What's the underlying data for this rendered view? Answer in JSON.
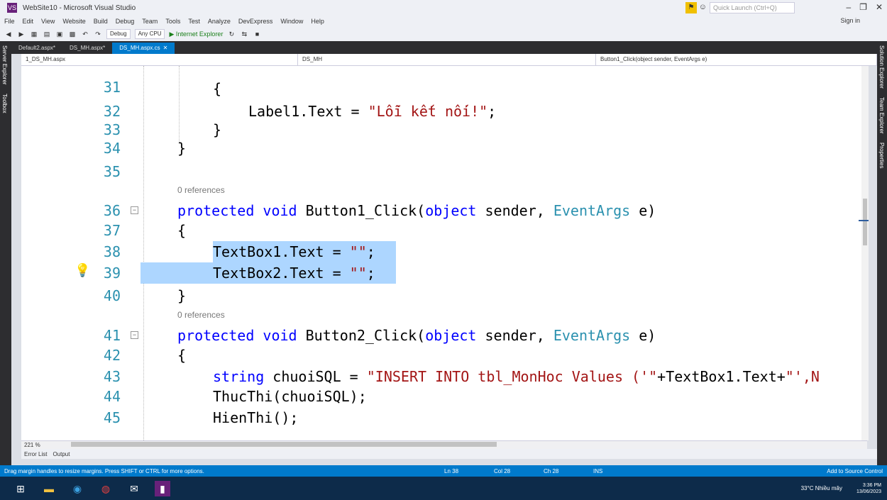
{
  "window": {
    "title": "WebSite10 - Microsoft Visual Studio",
    "quick_launch_placeholder": "Quick Launch (Ctrl+Q)",
    "sign_in": "Sign in"
  },
  "menu": [
    "File",
    "Edit",
    "View",
    "Website",
    "Build",
    "Debug",
    "Team",
    "Tools",
    "Test",
    "Analyze",
    "DevExpress",
    "Window",
    "Help"
  ],
  "toolbar": {
    "config": "Debug",
    "platform": "Any CPU",
    "run": "▶ Internet Explorer"
  },
  "tabs": [
    {
      "label": "Default2.aspx*",
      "active": false
    },
    {
      "label": "DS_MH.aspx*",
      "active": false
    },
    {
      "label": "DS_MH.aspx.cs",
      "active": true
    }
  ],
  "nav": {
    "project": "1_DS_MH.aspx",
    "class": "DS_MH",
    "member": "Button1_Click(object sender, EventArgs e)"
  },
  "side_left": [
    "Server Explorer",
    "Toolbox"
  ],
  "side_right": [
    "Solution Explorer",
    "Team Explorer",
    "Properties"
  ],
  "code": {
    "l31": "31",
    "l32": "32",
    "l33": "33",
    "l34": "34",
    "l35": "35",
    "l36": "36",
    "l37": "37",
    "l38": "38",
    "l39": "39",
    "l40": "40",
    "l41": "41",
    "l42": "42",
    "l43": "43",
    "l44": "44",
    "l45": "45",
    "ref1": "0 references",
    "ref2": "0 references",
    "c31": "{",
    "c32a": "Label1.Text = ",
    "c32b": "\"Lỗi kết nối!\"",
    "c32c": ";",
    "c33": "}",
    "c34": "}",
    "c36a": "protected",
    "c36b": " void",
    "c36c": " Button1_Click(",
    "c36d": "object",
    "c36e": " sender, ",
    "c36f": "EventArgs",
    "c36g": " e)",
    "c37": "{",
    "c38a": "TextBox1.Text = ",
    "c38b": "\"\"",
    "c38c": ";",
    "c39a": "TextBox2.Text = ",
    "c39b": "\"\"",
    "c39c": ";",
    "c40": "}",
    "c41a": "protected",
    "c41b": " void",
    "c41c": " Button2_Click(",
    "c41d": "object",
    "c41e": " sender, ",
    "c41f": "EventArgs",
    "c41g": " e)",
    "c42": "{",
    "c43a": "string",
    "c43b": " chuoiSQL = ",
    "c43c": "\"INSERT INTO tbl_MonHoc Values ('\"",
    "c43d": "+TextBox1.Text+",
    "c43e": "\"',N",
    "c44": "ThucThi(chuoiSQL);",
    "c45": "HienThi();"
  },
  "zoom": "221 %",
  "bottom_tabs": [
    "Error List",
    "Output"
  ],
  "status": {
    "message": "Drag margin handles to resize margins. Press SHIFT or CTRL for more options.",
    "ln": "Ln 38",
    "col": "Col 28",
    "ch": "Ch 28",
    "mode": "INS",
    "source_control": "Add to Source Control"
  },
  "taskbar": {
    "weather": "33°C Nhiều mây",
    "time": "3:36 PM",
    "date": "13/06/2023"
  }
}
